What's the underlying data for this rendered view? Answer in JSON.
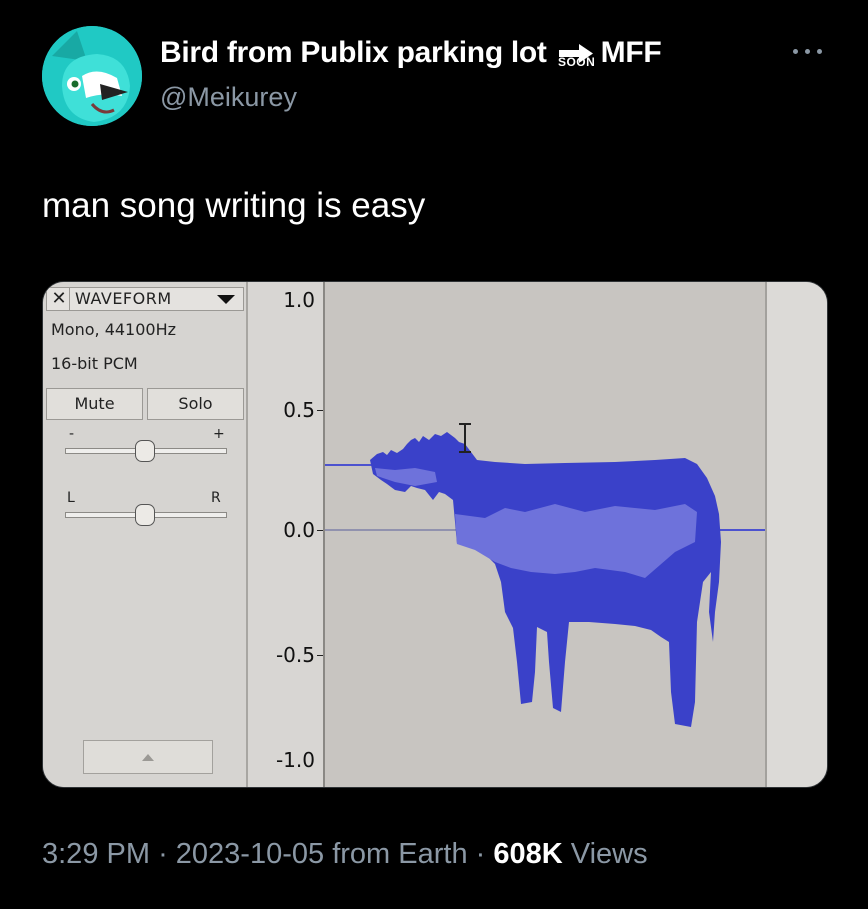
{
  "tweet": {
    "author": {
      "display_name": "Bird from Publix parking lot",
      "badge_text": "SOON",
      "display_name_suffix": "MFF",
      "handle": "@Meikurey"
    },
    "text": "man song writing is easy",
    "footer": {
      "time": "3:29 PM",
      "separator": "·",
      "date": "2023-10-05",
      "source": "from Earth",
      "views_count": "608K",
      "views_label": "Views"
    }
  },
  "audacity": {
    "track_name": "WAVEFORM",
    "format": "Mono, 44100Hz",
    "bit_depth": "16-bit PCM",
    "mute_label": "Mute",
    "solo_label": "Solo",
    "gain_minus": "-",
    "gain_plus": "+",
    "pan_left": "L",
    "pan_right": "R",
    "ruler": [
      "1.0",
      "0.5",
      "0.0",
      "-0.5",
      "-1.0"
    ],
    "colors": {
      "waveform_dark": "#3a41c9",
      "waveform_light": "#6e72db",
      "background": "#c8c5c1"
    }
  }
}
